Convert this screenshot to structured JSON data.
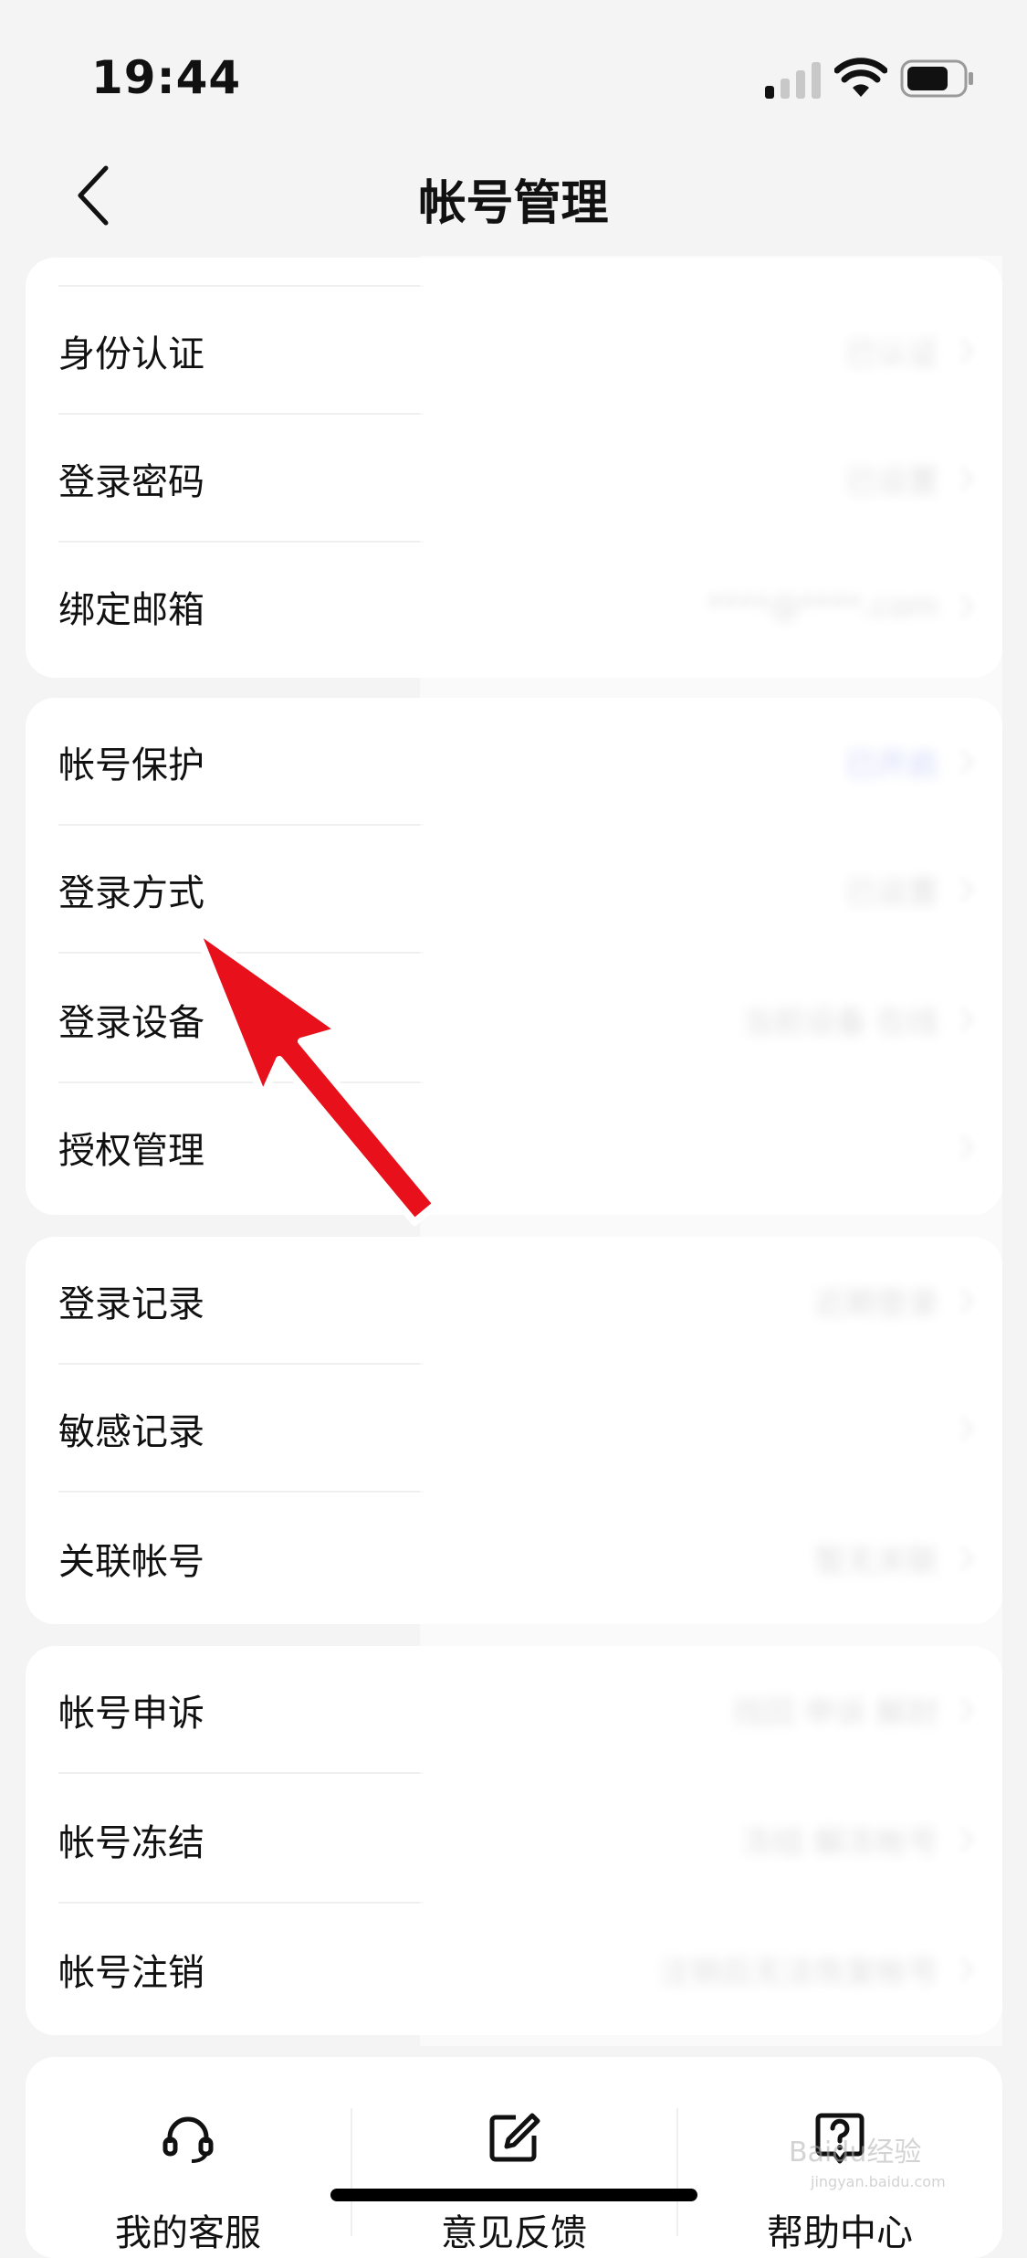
{
  "status_bar": {
    "time": "19:44"
  },
  "nav": {
    "title": "帐号管理"
  },
  "cards": [
    {
      "rows": [
        {
          "label": "身份认证",
          "value": "已认证"
        },
        {
          "label": "登录密码",
          "value": "已设置"
        },
        {
          "label": "绑定邮箱",
          "value": "****@****.com"
        }
      ]
    },
    {
      "rows": [
        {
          "label": "帐号保护",
          "value": "已开启"
        },
        {
          "label": "登录方式",
          "value": "已设置"
        },
        {
          "label": "登录设备",
          "value": "当前设备 在线"
        },
        {
          "label": "授权管理",
          "value": ""
        }
      ]
    },
    {
      "rows": [
        {
          "label": "登录记录",
          "value": "近期登录"
        },
        {
          "label": "敏感记录",
          "value": ""
        },
        {
          "label": "关联帐号",
          "value": "暂无关联"
        }
      ]
    },
    {
      "rows": [
        {
          "label": "帐号申诉",
          "value": "找回 申诉 解封"
        },
        {
          "label": "帐号冻结",
          "value": "冻结 解冻帐号"
        },
        {
          "label": "帐号注销",
          "value": "注销后无法恢复帐号"
        }
      ]
    }
  ],
  "toolbar": [
    {
      "label": "我的客服",
      "icon": "headset-icon"
    },
    {
      "label": "意见反馈",
      "icon": "edit-icon"
    },
    {
      "label": "帮助中心",
      "icon": "help-icon"
    }
  ],
  "watermark": {
    "brand": "Baidu经验",
    "url": "jingyan.baidu.com"
  },
  "colors": {
    "background": "#f4f4f4",
    "card": "#ffffff",
    "annotation": "#e8101a"
  }
}
